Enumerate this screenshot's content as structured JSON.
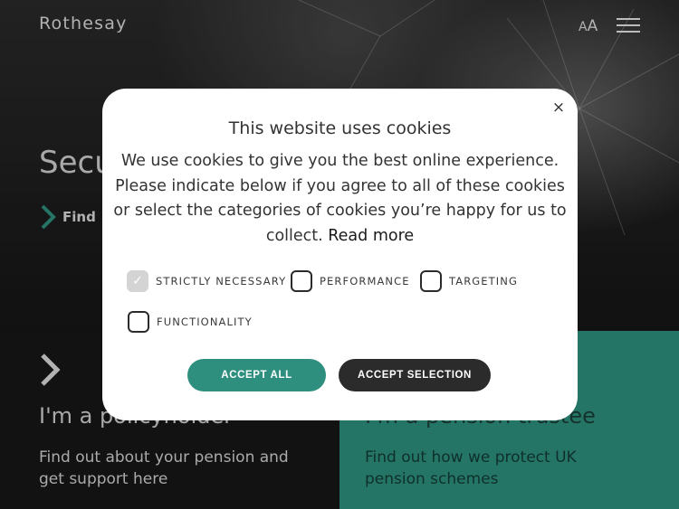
{
  "header": {
    "logo": "Rothesay",
    "text_size_small": "A",
    "text_size_large": "A",
    "menu_icon": "hamburger-icon"
  },
  "hero": {
    "title": "Secu",
    "link_label": "Find o"
  },
  "panels": [
    {
      "title": "I'm a policyholder",
      "description": "Find out about your pension and get support here"
    },
    {
      "title": "I'm a pension trustee",
      "description": "Find out how we protect UK pension schemes"
    }
  ],
  "cookie_modal": {
    "title": "This website uses cookies",
    "body": "We use cookies to give you the best online experience. Please indicate below if you agree to all of these cookies or select the categories of cookies you’re happy for us to collect.",
    "read_more": "Read more",
    "close_icon": "×",
    "options": [
      {
        "label": "STRICTLY NECESSARY",
        "checked": true
      },
      {
        "label": "PERFORMANCE",
        "checked": false
      },
      {
        "label": "TARGETING",
        "checked": false
      },
      {
        "label": "FUNCTIONALITY",
        "checked": false
      }
    ],
    "accept_all": "ACCEPT ALL",
    "accept_selection": "ACCEPT SELECTION"
  },
  "colors": {
    "accent_teal": "#2e8f7e",
    "dark_button": "#2b2b2b"
  }
}
